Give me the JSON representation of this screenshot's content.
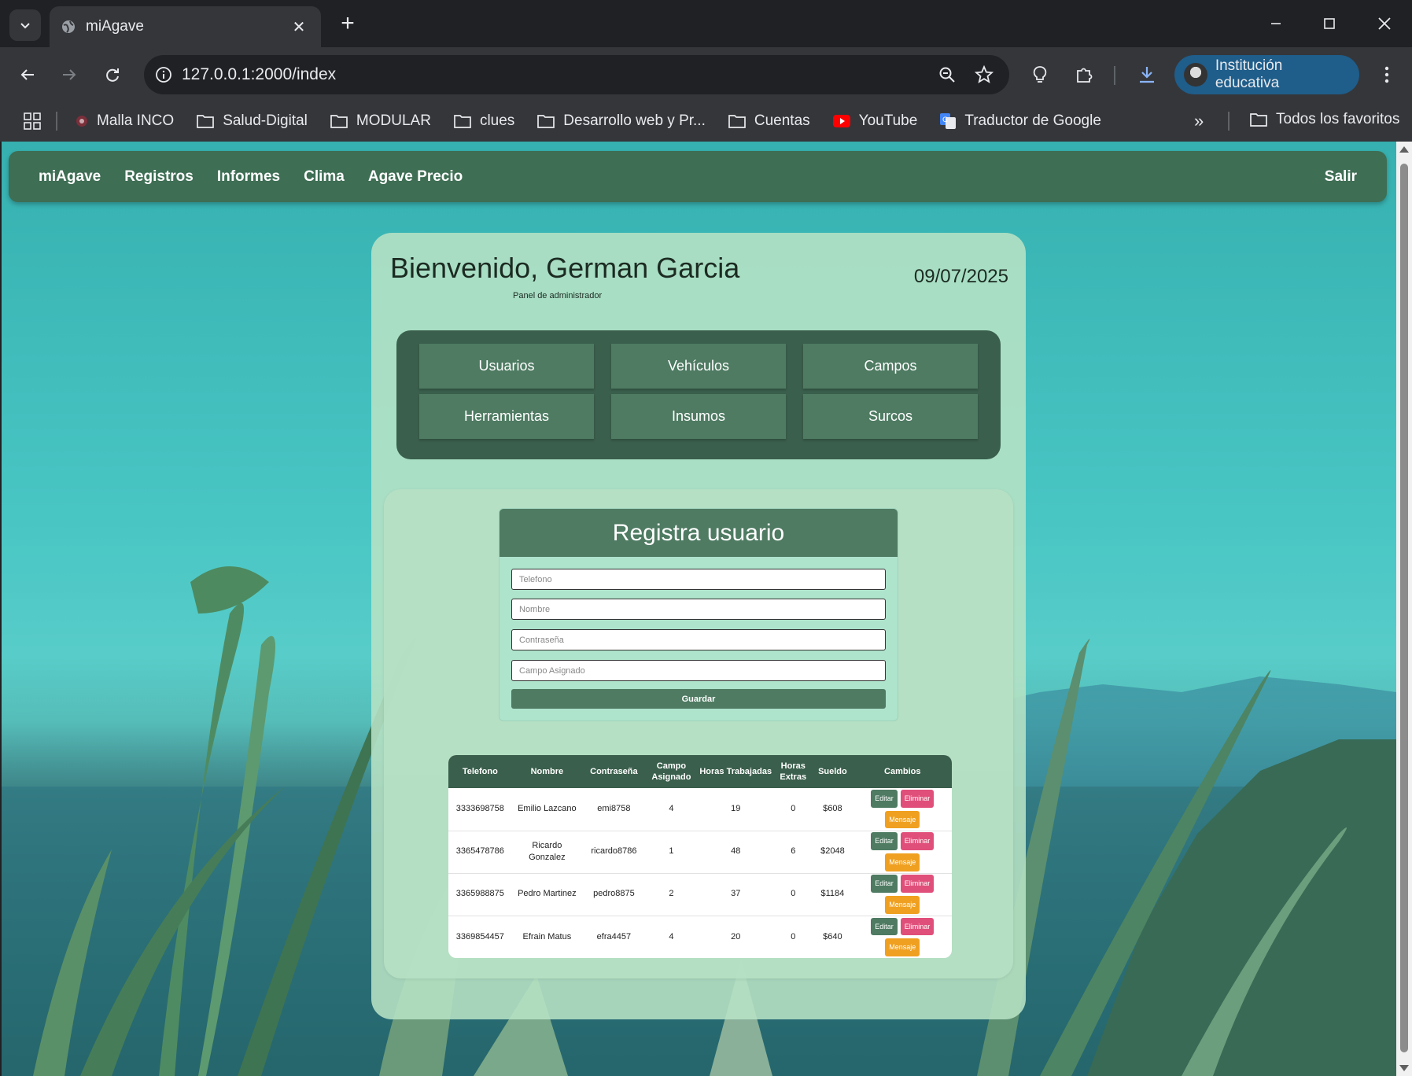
{
  "browser": {
    "tab_title": "miAgave",
    "url": "127.0.0.1:2000/index",
    "profile_label": "Institución educativa",
    "bookmarks": [
      {
        "label": "Malla INCO",
        "icon": "site-icon"
      },
      {
        "label": "Salud-Digital",
        "icon": "folder-icon"
      },
      {
        "label": "MODULAR",
        "icon": "folder-icon"
      },
      {
        "label": "clues",
        "icon": "folder-icon"
      },
      {
        "label": "Desarrollo web y Pr...",
        "icon": "folder-icon"
      },
      {
        "label": "Cuentas",
        "icon": "folder-icon"
      },
      {
        "label": "YouTube",
        "icon": "youtube-icon"
      },
      {
        "label": "Traductor de Google",
        "icon": "translate-icon"
      }
    ],
    "all_bookmarks_label": "Todos los favoritos"
  },
  "nav": {
    "links": [
      "miAgave",
      "Registros",
      "Informes",
      "Clima",
      "Agave Precio"
    ],
    "logout": "Salir",
    "color": "#3e6e54"
  },
  "header": {
    "welcome": "Bienvenido, German Garcia",
    "subtitle": "Panel de administrador",
    "date": "09/07/2025"
  },
  "menu": [
    "Usuarios",
    "Vehículos",
    "Campos",
    "Herramientas",
    "Insumos",
    "Surcos"
  ],
  "form": {
    "title": "Registra usuario",
    "placeholders": {
      "telefono": "Telefono",
      "nombre": "Nombre",
      "contrasena": "Contraseña",
      "campo": "Campo Asignado"
    },
    "submit": "Guardar"
  },
  "table": {
    "headers": [
      "Telefono",
      "Nombre",
      "Contraseña",
      "Campo Asignado",
      "Horas Trabajadas",
      "Horas Extras",
      "Sueldo",
      "Cambios"
    ],
    "actions": {
      "edit": "Editar",
      "delete": "Eliminar",
      "message": "Mensaje"
    },
    "rows": [
      {
        "telefono": "3333698758",
        "nombre": "Emilio Lazcano",
        "contrasena": "emi8758",
        "campo": "4",
        "horas": "19",
        "extras": "0",
        "sueldo": "$608"
      },
      {
        "telefono": "3365478786",
        "nombre": "Ricardo Gonzalez",
        "contrasena": "ricardo8786",
        "campo": "1",
        "horas": "48",
        "extras": "6",
        "sueldo": "$2048"
      },
      {
        "telefono": "3365988875",
        "nombre": "Pedro Martinez",
        "contrasena": "pedro8875",
        "campo": "2",
        "horas": "37",
        "extras": "0",
        "sueldo": "$1184"
      },
      {
        "telefono": "3369854457",
        "nombre": "Efrain Matus",
        "contrasena": "efra4457",
        "campo": "4",
        "horas": "20",
        "extras": "0",
        "sueldo": "$640"
      }
    ]
  }
}
